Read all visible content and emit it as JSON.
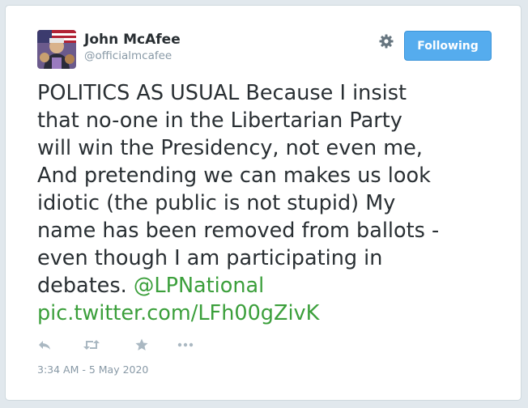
{
  "author": {
    "display_name": "John McAfee",
    "handle": "@officialmcafee",
    "avatar_icon": "user-avatar-photo"
  },
  "header": {
    "settings_icon": "gear-icon",
    "follow_button_label": "Following",
    "follow_button_color": "#55acee"
  },
  "tweet": {
    "lines": [
      "POLITICS AS USUAL Because I insist",
      "that no-one in the Libertarian Party",
      "will win the Presidency, not even me,",
      "And pretending we can makes us look",
      "idiotic (the public is not stupid) My",
      "name has been removed from ballots -",
      "even though I am participating in",
      "debates. "
    ],
    "mention": "@LPNational",
    "link": "pic.twitter.com/LFh00gZivK",
    "link_color": "#3b9f3b"
  },
  "actions": {
    "icons": [
      "reply-icon",
      "retweet-icon",
      "favorite-icon",
      "more-icon"
    ]
  },
  "timestamp": "3:34 AM - 5 May 2020"
}
